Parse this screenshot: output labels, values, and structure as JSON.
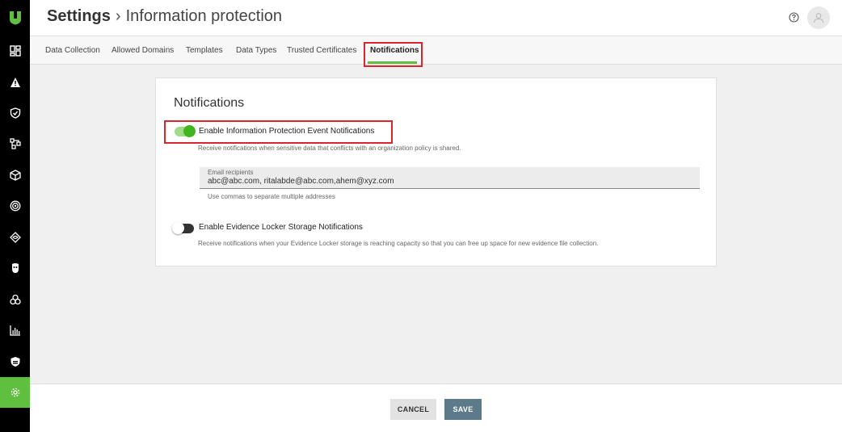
{
  "header": {
    "root_title": "Settings",
    "separator": "›",
    "page_title": "Information protection"
  },
  "tabs": [
    {
      "label": "Data Collection",
      "active": false
    },
    {
      "label": "Allowed Domains",
      "active": false
    },
    {
      "label": "Templates",
      "active": false
    },
    {
      "label": "Data Types",
      "active": false
    },
    {
      "label": "Trusted Certificates",
      "active": false
    },
    {
      "label": "Notifications",
      "active": true
    }
  ],
  "notifications": {
    "title": "Notifications",
    "event_toggle": {
      "label": "Enable Information Protection Event Notifications",
      "description": "Receive notifications when sensitive data that conflicts with an organization policy is shared.",
      "enabled": true
    },
    "email": {
      "label": "Email recipients",
      "value": "abc@abc.com, ritalabde@abc.com,ahem@xyz.com",
      "hint": "Use commas to separate multiple addresses"
    },
    "locker_toggle": {
      "label": "Enable Evidence Locker Storage Notifications",
      "description": "Receive notifications when your Evidence Locker storage is reaching capacity so that you can free up space for new evidence file collection.",
      "enabled": false
    }
  },
  "footer": {
    "cancel_label": "CANCEL",
    "save_label": "SAVE"
  },
  "sidebar": {
    "items": [
      "dashboard-icon",
      "alert-icon",
      "shield-check-icon",
      "network-icon",
      "cube-icon",
      "target-icon",
      "eye-icon",
      "mask-icon",
      "biohazard-icon",
      "bar-chart-icon",
      "shield-icon",
      "gear-icon"
    ],
    "active_item": "gear-icon"
  },
  "colors": {
    "accent": "#5fbf3f",
    "highlight": "#d9252d",
    "save_button": "#5c7a8a"
  }
}
